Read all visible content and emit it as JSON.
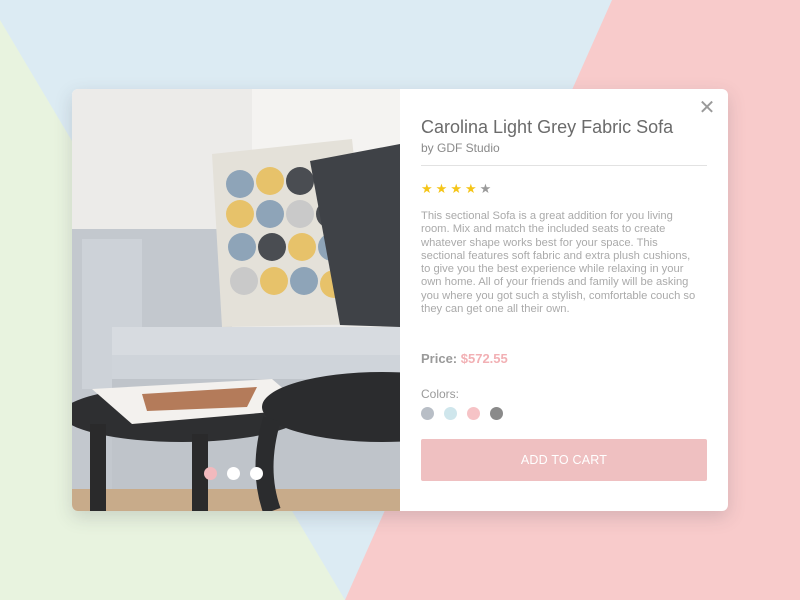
{
  "product": {
    "title": "Carolina Light Grey Fabric Sofa",
    "brand": "by GDF Studio",
    "rating": 4,
    "rating_max": 5,
    "description": "This sectional Sofa is a great addition for you living room. Mix and match the included seats to create whatever shape works best for your space. This sectional features soft fabric and extra plush cushions, to give you the best experience while relaxing in your own home. All of your friends and family will be asking you where you got such a stylish, comfortable couch so they can get one all their own.",
    "price_label": "Price:",
    "price": "$572.55",
    "colors_label": "Colors:",
    "colors": [
      "#b8bec6",
      "#cfe6ec",
      "#f6c3c6",
      "#8a8a8a"
    ],
    "add_to_cart": "ADD TO CART"
  },
  "gallery": {
    "slide_count": 3,
    "active_slide": 1
  },
  "theme": {
    "accent": "#f2b0b4",
    "button": "#efc0c1",
    "star": "#f5c518"
  }
}
